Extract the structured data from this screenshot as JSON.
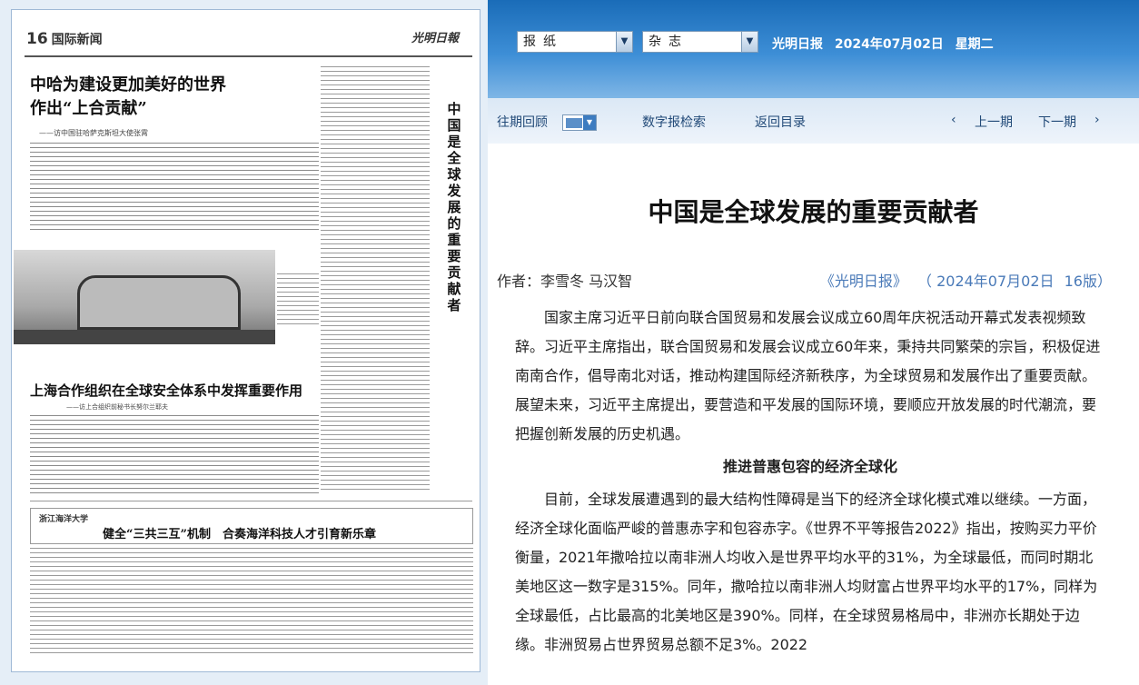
{
  "newspaper": {
    "page_label": "16",
    "section": "国际新闻",
    "logo": "光明日報",
    "headline1": "中哈为建设更加美好的世界作出“上合贡献”",
    "headline1_l1": "中哈为建设更加美好的世界",
    "headline1_l2": "作出“上合贡献”",
    "subhead1": "——访中国驻哈萨克斯坦大使张霄",
    "vertical_title": "中国是全球发展的重要贡献者",
    "headline2": "上海合作组织在全球安全体系中发挥重要作用",
    "subhead2": "——访上合组织前秘书长努尔兰耶夫",
    "university": "浙江海洋大学",
    "headline3": "健全“三共三互”机制　合奏海洋科技人才引育新乐章"
  },
  "toolbar": {
    "select1": "报纸",
    "select2": "杂志",
    "paper_name": "光明日报",
    "date": "2024年07月02日",
    "weekday": "星期二"
  },
  "nav": {
    "archive": "往期回顾",
    "digital_search": "数字报检索",
    "back_to_index": "返回目录",
    "prev_page": "上一期",
    "next_page": "下一期"
  },
  "article": {
    "title": "中国是全球发展的重要贡献者",
    "author_line": "作者：李雪冬  马汉智",
    "source_name": "《光明日报》",
    "source_date": "（ 2024年07月02日",
    "source_page": "16版）",
    "para1": "国家主席习近平日前向联合国贸易和发展会议成立60周年庆祝活动开幕式发表视频致辞。习近平主席指出，联合国贸易和发展会议成立60年来，秉持共同繁荣的宗旨，积极促进南南合作，倡导南北对话，推动构建国际经济新秩序，为全球贸易和发展作出了重要贡献。展望未来，习近平主席提出，要营造和平发展的国际环境，要顺应开放发展的时代潮流，要把握创新发展的历史机遇。",
    "subtitle": "推进普惠包容的经济全球化",
    "para2": "目前，全球发展遭遇到的最大结构性障碍是当下的经济全球化模式难以继续。一方面，经济全球化面临严峻的普惠赤字和包容赤字。《世界不平等报告2022》指出，按购买力平价衡量，2021年撒哈拉以南非洲人均收入是世界平均水平的31%，为全球最低，而同时期北美地区这一数字是315%。同年，撒哈拉以南非洲人均财富占世界平均水平的17%，同样为全球最低，占比最高的北美地区是390%。同样，在全球贸易格局中，非洲亦长期处于边缘。非洲贸易占世界贸易总额不足3%。2022"
  }
}
